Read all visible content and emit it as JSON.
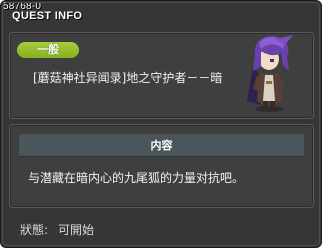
{
  "window": {
    "quest_code": "58768-0",
    "title": "QUEST INFO"
  },
  "quest": {
    "category_badge": "一般",
    "name": "[蘑菇神社异闻录]地之守护者－－暗",
    "avatar_icon": "purple-haired-character-icon"
  },
  "content_section": {
    "header": "内容",
    "description": "与潜藏在暗内心的九尾狐的力量对抗吧。"
  },
  "status": {
    "label": "狀態:",
    "value": "可開始"
  },
  "colors": {
    "badge": "#96c12e",
    "panel": "#3f3f3f",
    "window": "#363636",
    "section_header": "#4a555c"
  }
}
